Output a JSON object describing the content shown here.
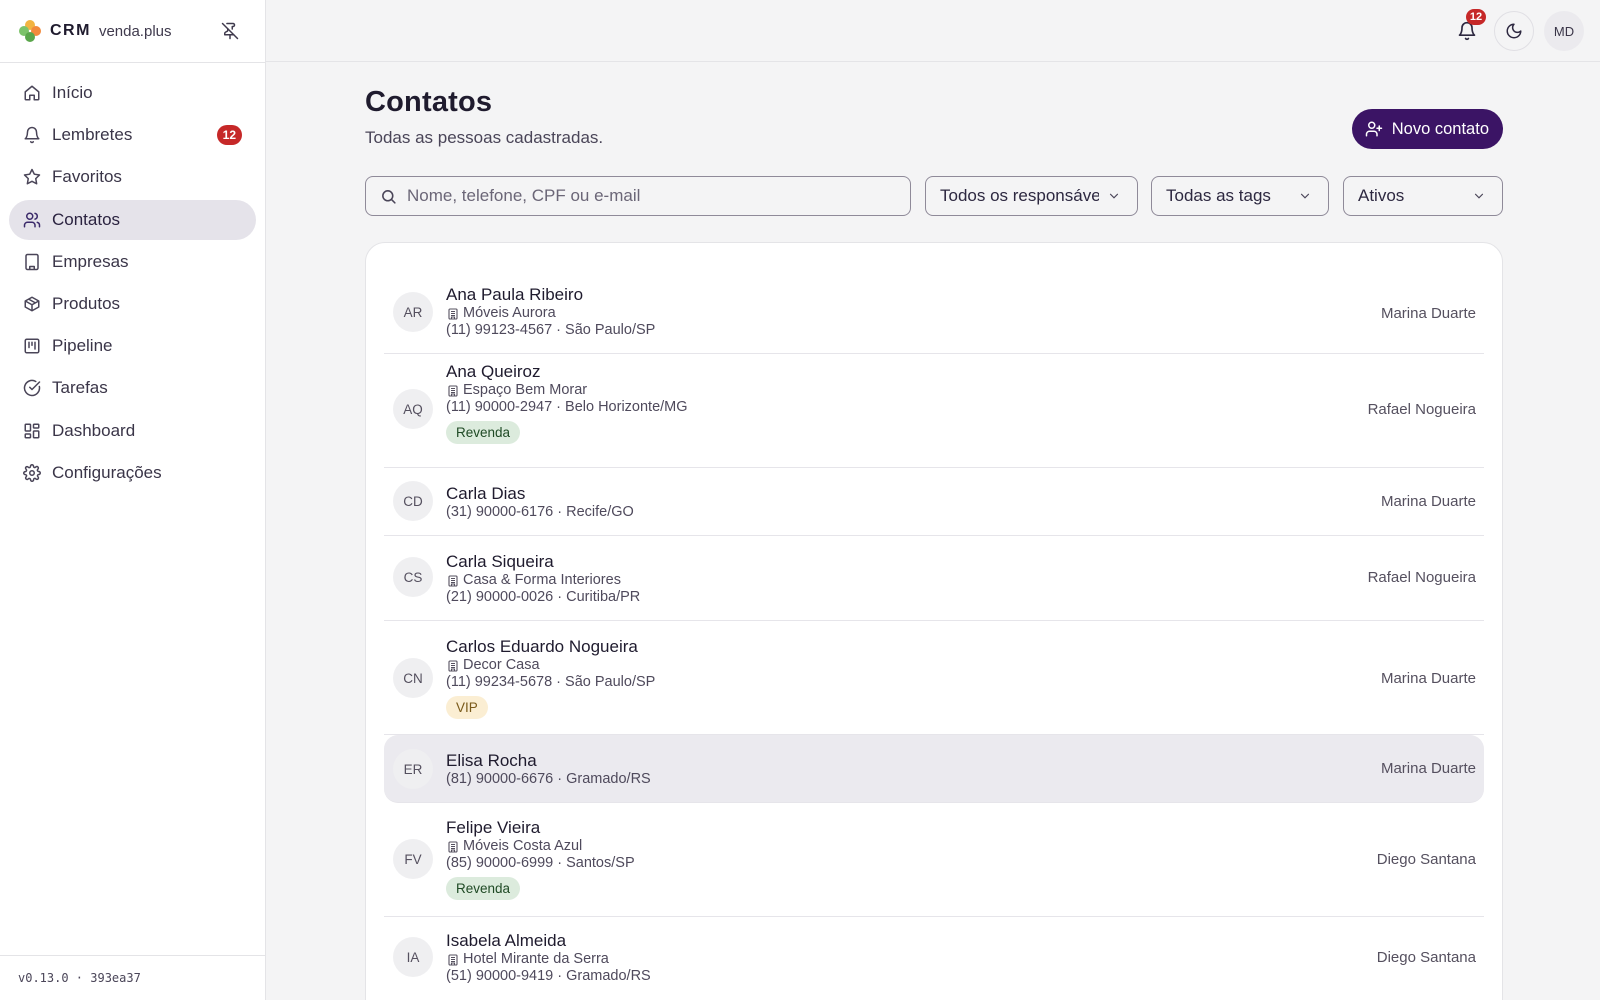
{
  "brand": {
    "crm": "CRM",
    "name": "venda.plus"
  },
  "sidebar": {
    "items": [
      {
        "label": "Início",
        "icon": "home-icon",
        "active": false
      },
      {
        "label": "Lembretes",
        "icon": "bell-icon",
        "active": false,
        "badge": "12"
      },
      {
        "label": "Favoritos",
        "icon": "star-icon",
        "active": false
      },
      {
        "label": "Contatos",
        "icon": "users-icon",
        "active": true
      },
      {
        "label": "Empresas",
        "icon": "building-icon",
        "active": false
      },
      {
        "label": "Produtos",
        "icon": "package-icon",
        "active": false
      },
      {
        "label": "Pipeline",
        "icon": "kanban-icon",
        "active": false
      },
      {
        "label": "Tarefas",
        "icon": "check-circle-icon",
        "active": false
      },
      {
        "label": "Dashboard",
        "icon": "dashboard-icon",
        "active": false
      },
      {
        "label": "Configurações",
        "icon": "gear-icon",
        "active": false
      }
    ],
    "version": "v0.13.0 · 393ea37"
  },
  "topbar": {
    "notifications_count": "12",
    "user_initials": "MD"
  },
  "page": {
    "title": "Contatos",
    "subtitle": "Todas as pessoas cadastradas.",
    "new_button_label": "Novo contato"
  },
  "filters": {
    "search_placeholder": "Nome, telefone, CPF ou e-mail",
    "responsible": "Todos os responsáveis",
    "tags": "Todas as tags",
    "status": "Ativos"
  },
  "contacts": [
    {
      "initials": "AR",
      "name": "Ana Paula Ribeiro",
      "company": "Móveis Aurora",
      "contact": "(11) 99123-4567 · São Paulo/SP",
      "tag": "",
      "owner": "Marina Duarte"
    },
    {
      "initials": "AQ",
      "name": "Ana Queiroz",
      "company": "Espaço Bem Morar",
      "contact": "(11) 90000-2947 · Belo Horizonte/MG",
      "tag": "Revenda",
      "owner": "Rafael Nogueira"
    },
    {
      "initials": "CD",
      "name": "Carla Dias",
      "company": "",
      "contact": "(31) 90000-6176 · Recife/GO",
      "tag": "",
      "owner": "Marina Duarte"
    },
    {
      "initials": "CS",
      "name": "Carla Siqueira",
      "company": "Casa & Forma Interiores",
      "contact": "(21) 90000-0026 · Curitiba/PR",
      "tag": "",
      "owner": "Rafael Nogueira"
    },
    {
      "initials": "CN",
      "name": "Carlos Eduardo Nogueira",
      "company": "Decor Casa",
      "contact": "(11) 99234-5678 · São Paulo/SP",
      "tag": "VIP",
      "owner": "Marina Duarte"
    },
    {
      "initials": "ER",
      "name": "Elisa Rocha",
      "company": "",
      "contact": "(81) 90000-6676 · Gramado/RS",
      "tag": "",
      "owner": "Marina Duarte"
    },
    {
      "initials": "FV",
      "name": "Felipe Vieira",
      "company": "Móveis Costa Azul",
      "contact": "(85) 90000-6999 · Santos/SP",
      "tag": "Revenda",
      "owner": "Diego Santana"
    },
    {
      "initials": "IA",
      "name": "Isabela Almeida",
      "company": "Hotel Mirante da Serra",
      "contact": "(51) 90000-9419 · Gramado/RS",
      "tag": "",
      "owner": "Diego Santana"
    }
  ],
  "colors": {
    "accent": "#3b1465",
    "badge": "#c62828",
    "active_nav": "#e5e3ea"
  }
}
